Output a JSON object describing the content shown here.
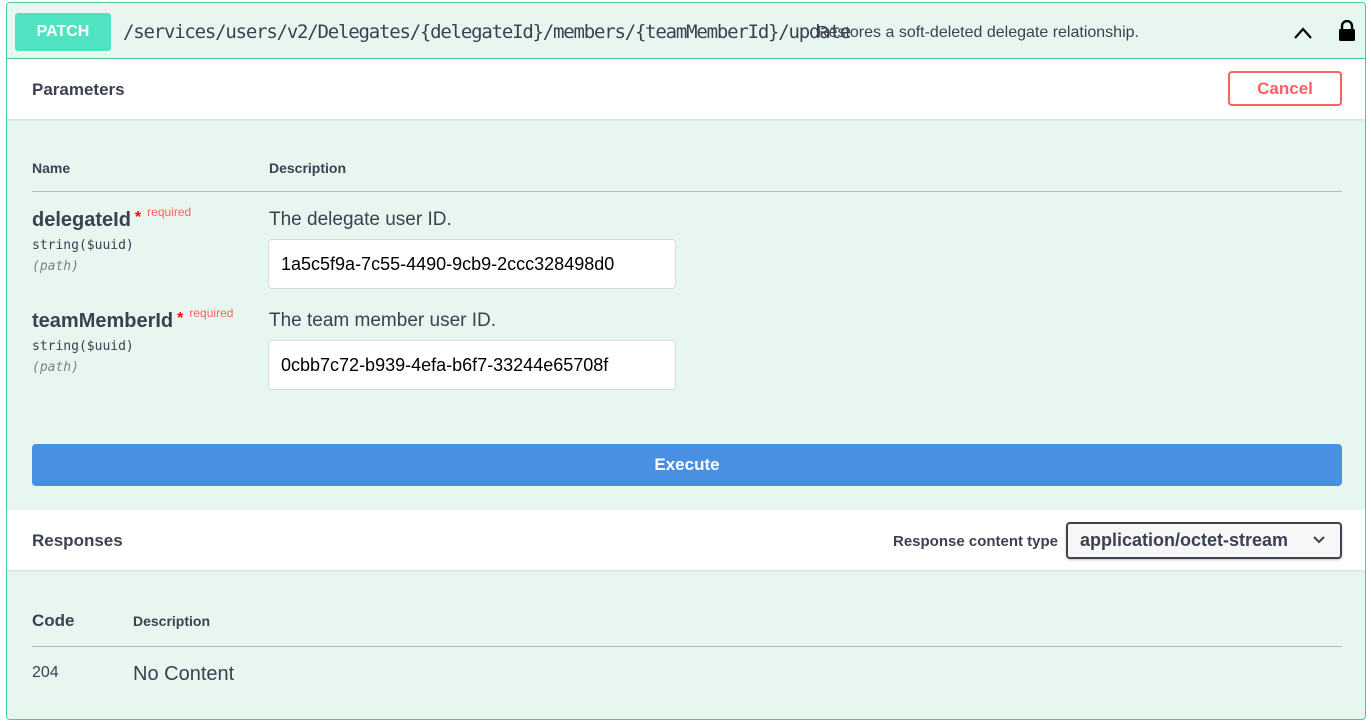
{
  "operation": {
    "method": "PATCH",
    "path": "/services/users/v2/Delegates/{delegateId}/members/{teamMemberId}/update",
    "summary": "Restores a soft-deleted delegate relationship.",
    "method_color": "#50e3c2",
    "border_color": "#49cc90"
  },
  "icons": {
    "collapse": "chevron-up-icon",
    "auth": "lock-icon"
  },
  "parameters": {
    "title": "Parameters",
    "cancel_label": "Cancel",
    "col_name": "Name",
    "col_description": "Description",
    "items": [
      {
        "name": "delegateId",
        "required_mark": "*",
        "required_label": "required",
        "type": "string($uuid)",
        "in": "(path)",
        "description": "The delegate user ID.",
        "value": "1a5c5f9a-7c55-4490-9cb9-2ccc328498d0"
      },
      {
        "name": "teamMemberId",
        "required_mark": "*",
        "required_label": "required",
        "type": "string($uuid)",
        "in": "(path)",
        "description": "The team member user ID.",
        "value": "0cbb7c72-b939-4efa-b6f7-33244e65708f"
      }
    ]
  },
  "execute": {
    "label": "Execute",
    "color": "#4990e2"
  },
  "responses": {
    "title": "Responses",
    "content_type_label": "Response content type",
    "content_type_value": "application/octet-stream",
    "col_code": "Code",
    "col_description": "Description",
    "rows": [
      {
        "code": "204",
        "description": "No Content"
      }
    ]
  }
}
